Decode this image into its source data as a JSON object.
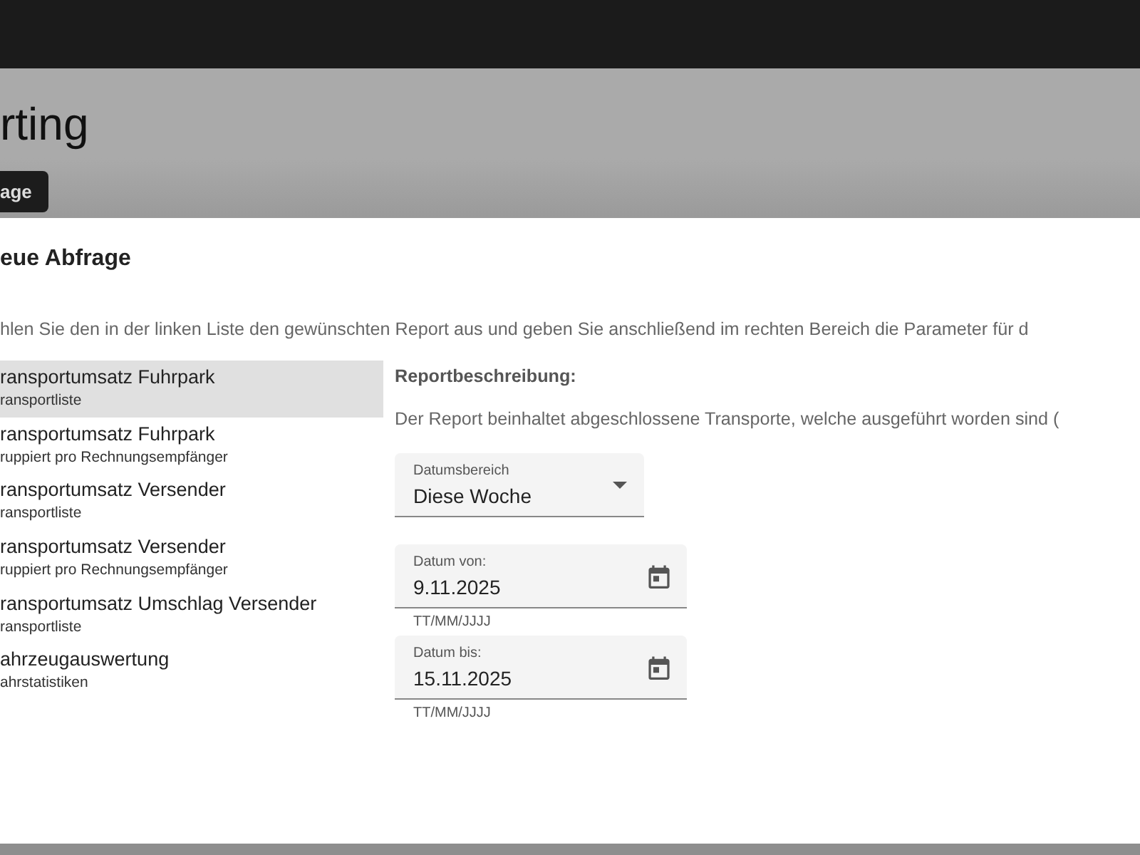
{
  "header": {
    "title": "rting",
    "button": "age"
  },
  "dialog": {
    "title": "eue Abfrage",
    "instruction": "hlen Sie den in der linken Liste den gewünschten Report aus und geben Sie anschließend im rechten Bereich die Parameter für d",
    "reports": [
      {
        "title": "ransportumsatz Fuhrpark",
        "subtitle": "ransportliste",
        "selected": true
      },
      {
        "title": "ransportumsatz Fuhrpark",
        "subtitle": "ruppiert pro Rechnungsempfänger",
        "selected": false
      },
      {
        "title": "ransportumsatz Versender",
        "subtitle": "ransportliste",
        "selected": false
      },
      {
        "title": "ransportumsatz Versender",
        "subtitle": "ruppiert pro Rechnungsempfänger",
        "selected": false
      },
      {
        "title": "ransportumsatz Umschlag Versender",
        "subtitle": "ransportliste",
        "selected": false
      },
      {
        "title": "ahrzeugauswertung",
        "subtitle": "ahrstatistiken",
        "selected": false
      }
    ],
    "description_heading": "Reportbeschreibung:",
    "description": "Der Report beinhaltet abgeschlossene Transporte, welche ausgeführt worden sind (",
    "date_range": {
      "label": "Datumsbereich",
      "value": "Diese Woche"
    },
    "date_fields": [
      {
        "label": "Datum von:",
        "value": "9.11.2025",
        "helper": "TT/MM/JJJJ"
      },
      {
        "label": "Datum bis:",
        "value": "15.11.2025",
        "helper": "TT/MM/JJJJ"
      }
    ]
  }
}
